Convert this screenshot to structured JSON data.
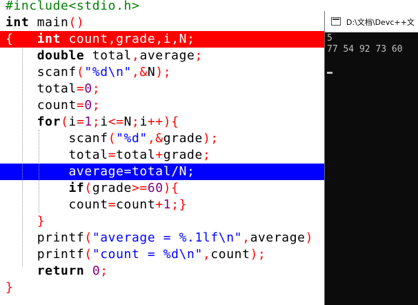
{
  "editor": {
    "lines": [
      [
        [
          "pp",
          "#include<stdio.h>"
        ]
      ],
      [
        [
          "kw",
          "int"
        ],
        [
          "id",
          " main"
        ],
        [
          "op",
          "()"
        ]
      ],
      [
        [
          "op",
          "{"
        ],
        [
          "id",
          "   "
        ],
        [
          "kw",
          "int"
        ],
        [
          "id",
          " count"
        ],
        [
          "op",
          ","
        ],
        [
          "id",
          "grade"
        ],
        [
          "op",
          ","
        ],
        [
          "id",
          "i"
        ],
        [
          "op",
          ","
        ],
        [
          "id",
          "N"
        ],
        [
          "op",
          ";"
        ]
      ],
      [
        [
          "id",
          "    "
        ],
        [
          "kw",
          "double"
        ],
        [
          "id",
          " total"
        ],
        [
          "op",
          ","
        ],
        [
          "id",
          "average"
        ],
        [
          "op",
          ";"
        ]
      ],
      [
        [
          "id",
          "    scanf"
        ],
        [
          "op",
          "("
        ],
        [
          "str",
          "\"%d\\n\""
        ],
        [
          "op",
          ",&"
        ],
        [
          "id",
          "N"
        ],
        [
          "op",
          ");"
        ]
      ],
      [
        [
          "id",
          "    total"
        ],
        [
          "op",
          "="
        ],
        [
          "num",
          "0"
        ],
        [
          "op",
          ";"
        ]
      ],
      [
        [
          "id",
          "    count"
        ],
        [
          "op",
          "="
        ],
        [
          "num",
          "0"
        ],
        [
          "op",
          ";"
        ]
      ],
      [
        [
          "id",
          "    "
        ],
        [
          "kw",
          "for"
        ],
        [
          "op",
          "("
        ],
        [
          "id",
          "i"
        ],
        [
          "op",
          "="
        ],
        [
          "num",
          "1"
        ],
        [
          "op",
          ";"
        ],
        [
          "id",
          "i"
        ],
        [
          "op",
          "<="
        ],
        [
          "id",
          "N"
        ],
        [
          "op",
          ";"
        ],
        [
          "id",
          "i"
        ],
        [
          "op",
          "++){"
        ]
      ],
      [
        [
          "id",
          "        scanf"
        ],
        [
          "op",
          "("
        ],
        [
          "str",
          "\"%d\""
        ],
        [
          "op",
          ",&"
        ],
        [
          "id",
          "grade"
        ],
        [
          "op",
          ");"
        ]
      ],
      [
        [
          "id",
          "        total"
        ],
        [
          "op",
          "="
        ],
        [
          "id",
          "total"
        ],
        [
          "op",
          "+"
        ],
        [
          "id",
          "grade"
        ],
        [
          "op",
          ";"
        ]
      ],
      [
        [
          "id",
          "        average"
        ],
        [
          "op",
          "="
        ],
        [
          "id",
          "total"
        ],
        [
          "op",
          "/"
        ],
        [
          "id",
          "N"
        ],
        [
          "op",
          ";"
        ]
      ],
      [
        [
          "id",
          "        "
        ],
        [
          "kw",
          "if"
        ],
        [
          "op",
          "("
        ],
        [
          "id",
          "grade"
        ],
        [
          "op",
          ">="
        ],
        [
          "num",
          "60"
        ],
        [
          "op",
          "){"
        ]
      ],
      [
        [
          "id",
          "        count"
        ],
        [
          "op",
          "="
        ],
        [
          "id",
          "count"
        ],
        [
          "op",
          "+"
        ],
        [
          "num",
          "1"
        ],
        [
          "op",
          ";}"
        ]
      ],
      [
        [
          "id",
          "    "
        ],
        [
          "op",
          "}"
        ]
      ],
      [
        [
          "id",
          "    printf"
        ],
        [
          "op",
          "("
        ],
        [
          "str",
          "\"average = %.1lf\\n\""
        ],
        [
          "op",
          ","
        ],
        [
          "id",
          "average"
        ],
        [
          "op",
          ")"
        ]
      ],
      [
        [
          "id",
          "    printf"
        ],
        [
          "op",
          "("
        ],
        [
          "str",
          "\"count = %d\\n\""
        ],
        [
          "op",
          ","
        ],
        [
          "id",
          "count"
        ],
        [
          "op",
          ");"
        ]
      ],
      [
        [
          "id",
          "    "
        ],
        [
          "kw",
          "return"
        ],
        [
          "id",
          " "
        ],
        [
          "num",
          "0"
        ],
        [
          "op",
          ";"
        ]
      ],
      [
        [
          "op",
          "}"
        ]
      ]
    ],
    "highlight_red_line": 2,
    "highlight_blue_line": 10
  },
  "console": {
    "title": "D:\\文档\\Devc++文",
    "output": [
      "5",
      "77 54 92 73 60"
    ]
  },
  "colors": {
    "error_highlight": "#ff0000",
    "execution_highlight": "#0000ff",
    "keyword": "#000000",
    "operator": "#ff0000",
    "number": "#800080",
    "string": "#0000ff",
    "preprocessor": "#008000",
    "console_bg": "#0c0c0c",
    "console_text": "#c0c0c0"
  }
}
